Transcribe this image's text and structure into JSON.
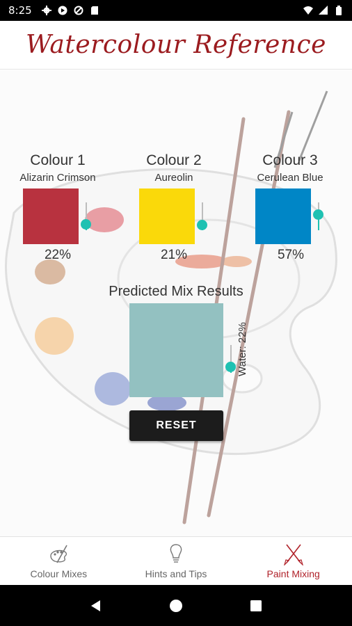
{
  "status_bar": {
    "time": "8:25"
  },
  "header": {
    "title": "Watercolour Reference"
  },
  "colours": [
    {
      "heading": "Colour 1",
      "name": "Alizarin Crimson",
      "color": "#b8323f",
      "percent_label": "22%",
      "level": 0.22
    },
    {
      "heading": "Colour 2",
      "name": "Aureolin",
      "color": "#fad90a",
      "percent_label": "21%",
      "level": 0.21
    },
    {
      "heading": "Colour 3",
      "name": "Cerulean Blue",
      "color": "#0086c6",
      "percent_label": "57%",
      "level": 0.57
    }
  ],
  "mix": {
    "label": "Predicted Mix Results",
    "color": "#93c1c1",
    "water_label": "Water: 22%",
    "water_level": 0.22
  },
  "reset_label": "RESET",
  "bottom_nav": [
    {
      "label": "Colour Mixes",
      "icon": "palette-icon",
      "active": false
    },
    {
      "label": "Hints and Tips",
      "icon": "lightbulb-icon",
      "active": false
    },
    {
      "label": "Paint Mixing",
      "icon": "crossed-brushes-icon",
      "active": true
    }
  ],
  "accent_color": "#b0222a",
  "slider_color": "#1fc1b2"
}
